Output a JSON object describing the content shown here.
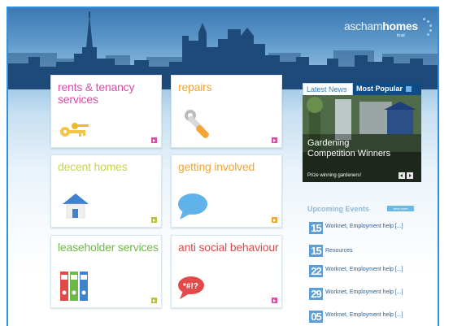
{
  "brand": {
    "name_part1": "ascham",
    "name_part2": "homes",
    "tagline": "trust"
  },
  "tiles": [
    {
      "title": "rents & tenancy services",
      "icon": "keys-icon",
      "color": "#d84ea8",
      "arrow_color": "#d84ea8"
    },
    {
      "title": "repairs",
      "icon": "wrench-icon",
      "color": "#f2a535",
      "arrow_color": "#d84ea8"
    },
    {
      "title": "decent homes",
      "icon": "house-icon",
      "color": "#c8d24c",
      "arrow_color": "#b8c23c"
    },
    {
      "title": "getting involved",
      "icon": "speech-bubble-icon",
      "color": "#f2a535",
      "arrow_color": "#f2a535"
    },
    {
      "title": "leaseholder services",
      "icon": "binders-icon",
      "color": "#6fb847",
      "arrow_color": "#b8c23c"
    },
    {
      "title": "anti social behaviour",
      "icon": "swear-bubble-icon",
      "color": "#e24a4a",
      "arrow_color": "#d84ea8"
    }
  ],
  "news": {
    "tab_latest": "Latest News",
    "tab_popular": "Most Popular",
    "feature_title": "Gardening Competition Winners",
    "feature_caption": "Prize winning gardeners!"
  },
  "events": {
    "title": "Upcoming Events",
    "view_more": "view more",
    "items": [
      {
        "date": "15",
        "text": "Worknet, Employment help [...]"
      },
      {
        "date": "15",
        "text": "Resources"
      },
      {
        "date": "22",
        "text": "Worknet, Employment help [...]"
      },
      {
        "date": "29",
        "text": "Worknet, Employment help [...]"
      },
      {
        "date": "05",
        "text": "Worknet, Employment help [...]"
      }
    ]
  }
}
